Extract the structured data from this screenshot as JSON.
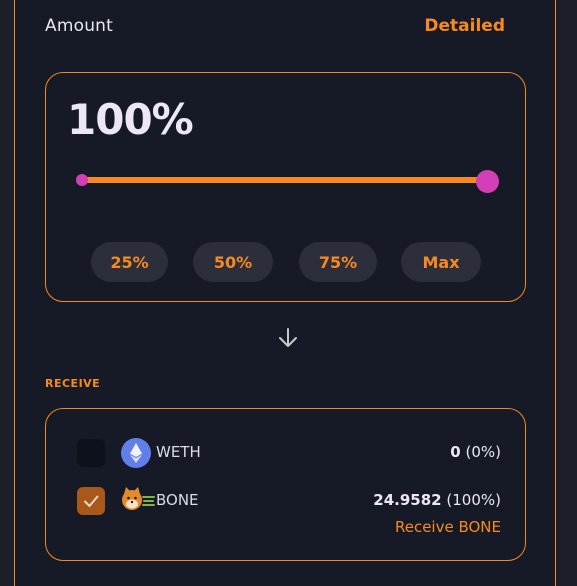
{
  "header": {
    "amount_label": "Amount",
    "detailed_label": "Detailed"
  },
  "slider": {
    "value_text": "100%",
    "value_fraction": 1.0
  },
  "presets": [
    "25%",
    "50%",
    "75%",
    "Max"
  ],
  "receive": {
    "heading": "RECEIVE",
    "tokens": [
      {
        "name": "WETH",
        "checked": false,
        "amount": "0",
        "percent": "(0%)",
        "icon": "ethereum-icon"
      },
      {
        "name": "BONE",
        "checked": true,
        "amount": "24.9582",
        "percent": "(100%)",
        "icon": "shiba-bone-icon"
      }
    ],
    "receive_link": "Receive BONE"
  },
  "colors": {
    "accent": "#f8891f",
    "slider_thumb": "#d43fb8",
    "background": "#151a26"
  }
}
